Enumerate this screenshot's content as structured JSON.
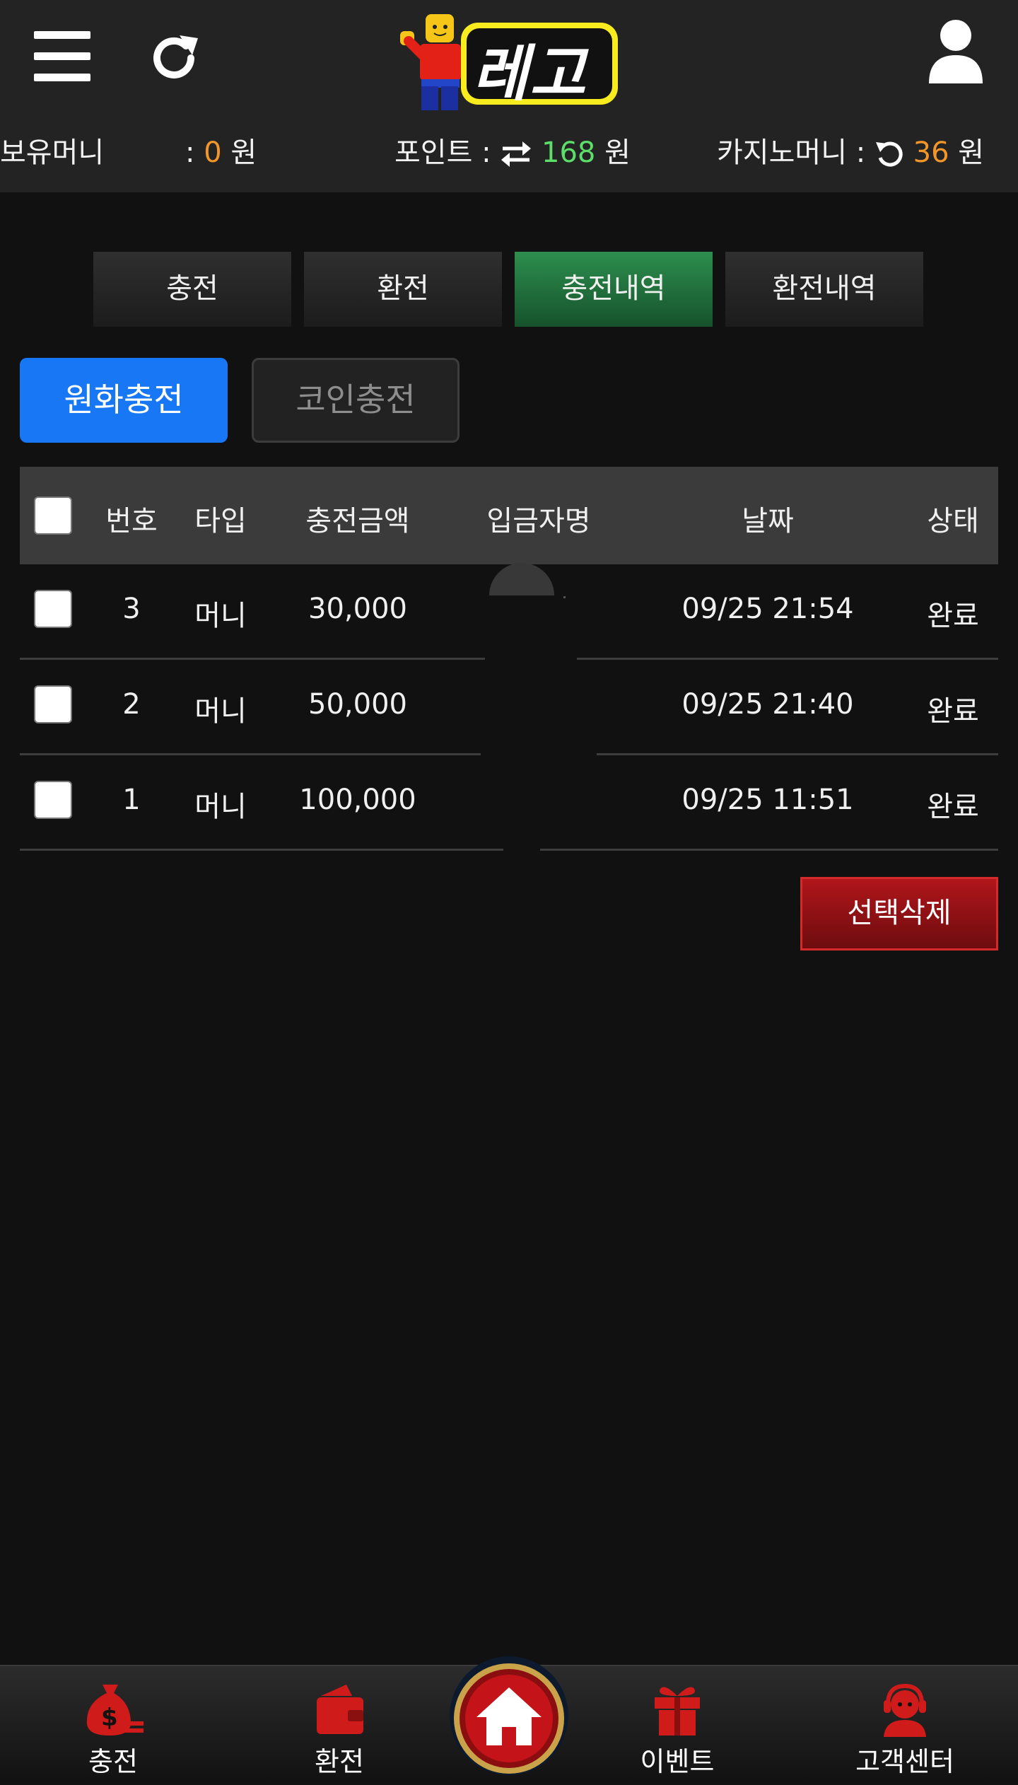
{
  "brand": {
    "logo_text": "레고"
  },
  "balances": {
    "money_label": "보유머니",
    "money_sep": ":",
    "money_value": "0",
    "money_unit": "원",
    "point_label": "포인트 :",
    "point_value": "168",
    "point_unit": "원",
    "casino_label": "카지노머니 :",
    "casino_value": "36",
    "casino_unit": "원"
  },
  "tabs": [
    {
      "label": "충전",
      "active": false
    },
    {
      "label": "환전",
      "active": false
    },
    {
      "label": "충전내역",
      "active": true
    },
    {
      "label": "환전내역",
      "active": false
    }
  ],
  "subtabs": {
    "primary": "원화충전",
    "secondary": "코인충전"
  },
  "table": {
    "headers": {
      "no": "번호",
      "type": "타입",
      "amount": "충전금액",
      "depositor": "입금자명",
      "date": "날짜",
      "status": "상태"
    },
    "rows": [
      {
        "no": "3",
        "type": "머니",
        "amount": "30,000",
        "depositor": "",
        "date": "09/25 21:54",
        "status": "완료"
      },
      {
        "no": "2",
        "type": "머니",
        "amount": "50,000",
        "depositor": "",
        "date": "09/25 21:40",
        "status": "완료"
      },
      {
        "no": "1",
        "type": "머니",
        "amount": "100,000",
        "depositor": "",
        "date": "09/25 11:51",
        "status": "완료"
      }
    ]
  },
  "delete_button": "선택삭제",
  "bottom_nav": {
    "charge": "충전",
    "exchange": "환전",
    "event": "이벤트",
    "support": "고객센터"
  },
  "colors": {
    "accent_orange": "#f2962a",
    "accent_green": "#5dde6a",
    "primary_blue": "#1877f5",
    "danger_red": "#b0161b",
    "active_tab": "#2d8e4e"
  },
  "icons": [
    "menu-icon",
    "refresh-icon",
    "user-icon",
    "exchange-arrows-icon",
    "undo-icon",
    "money-bag-icon",
    "wallet-icon",
    "home-icon",
    "gift-icon",
    "support-agent-icon"
  ]
}
